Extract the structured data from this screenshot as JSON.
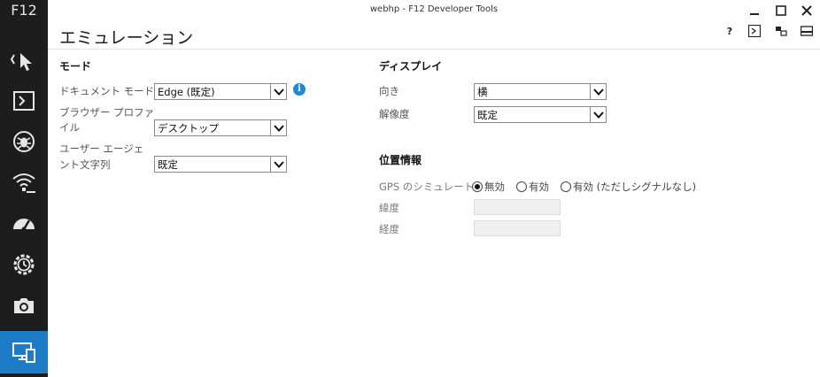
{
  "window": {
    "title": "webhp - F12 Developer Tools",
    "controls": {
      "minimize_icon": "minimize-icon",
      "maximize_icon": "maximize-icon",
      "close_icon": "close-icon"
    }
  },
  "rail": {
    "brand": "F12",
    "items": [
      {
        "name": "dom-explorer",
        "icon": "cursor-icon"
      },
      {
        "name": "console",
        "icon": "console-icon"
      },
      {
        "name": "debugger",
        "icon": "bug-icon"
      },
      {
        "name": "network",
        "icon": "wifi-icon"
      },
      {
        "name": "performance",
        "icon": "gauge-icon"
      },
      {
        "name": "memory",
        "icon": "clock-gear-icon"
      },
      {
        "name": "screenshot",
        "icon": "camera-icon"
      },
      {
        "name": "emulation",
        "icon": "devices-icon",
        "active": true
      }
    ],
    "active_color": "#1e7bc7"
  },
  "header": {
    "title": "エミュレーション",
    "tools": [
      "help-icon",
      "console-icon",
      "dock-icon",
      "undock-icon"
    ],
    "help_label": "?"
  },
  "mode": {
    "heading": "モード",
    "document_mode_label": "ドキュメント モード",
    "document_mode_value": "Edge (既定)",
    "browser_profile_label_1": "ブラウザー プロファ",
    "browser_profile_label_2": "イル",
    "browser_profile_value": "デスクトップ",
    "user_agent_label_1": "ユーザー エージェ",
    "user_agent_label_2": "ント文字列",
    "user_agent_value": "既定",
    "info_icon": "i"
  },
  "display": {
    "heading": "ディスプレイ",
    "orientation_label": "向き",
    "orientation_value": "横",
    "resolution_label": "解像度",
    "resolution_value": "既定"
  },
  "geolocation": {
    "heading": "位置情報",
    "gps_label": "GPS のシミュレート",
    "options": [
      {
        "label": "無効",
        "selected": true
      },
      {
        "label": "有効",
        "selected": false
      },
      {
        "label": "有効 (ただしシグナルなし)",
        "selected": false
      }
    ],
    "latitude_label": "緯度",
    "longitude_label": "経度",
    "latitude_value": "",
    "longitude_value": ""
  }
}
